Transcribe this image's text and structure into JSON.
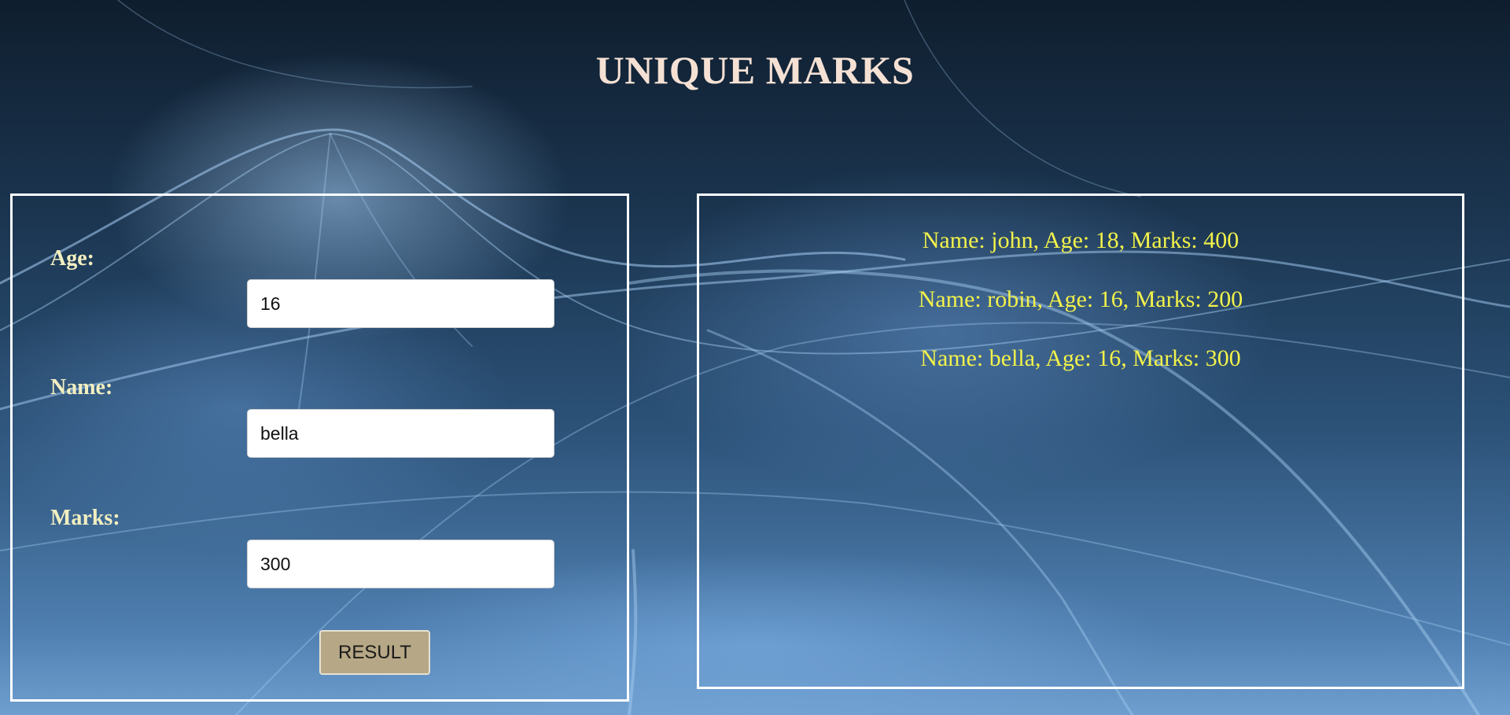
{
  "page": {
    "title": "UNIQUE MARKS"
  },
  "form": {
    "age_label": "Age:",
    "age_value": "16",
    "name_label": "Name:",
    "name_value": "bella",
    "marks_label": "Marks:",
    "marks_value": "300",
    "submit_label": "RESULT"
  },
  "results": {
    "lines": [
      "Name: john, Age: 18, Marks: 400",
      "Name: robin, Age: 16, Marks: 200",
      "Name: bella, Age: 16, Marks: 300"
    ]
  },
  "colors": {
    "title": "#f5e1d4",
    "labels": "#f3efc0",
    "result_text": "#f2f24a",
    "button_bg": "#b6a886",
    "panel_border": "#ffffff"
  }
}
